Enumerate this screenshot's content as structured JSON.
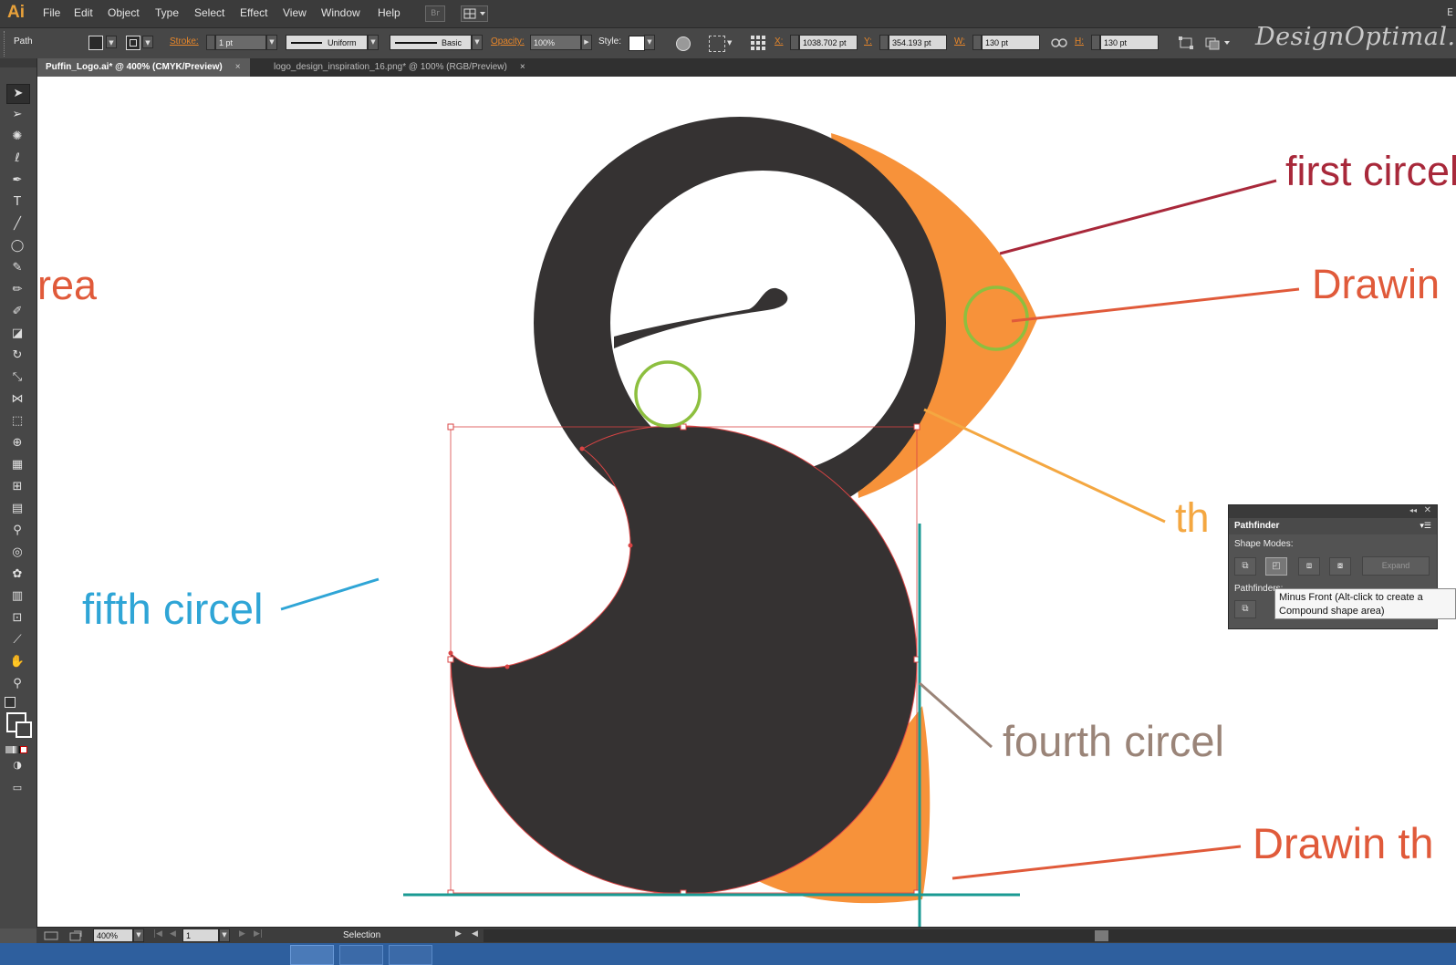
{
  "app": {
    "logo": "Ai"
  },
  "menu": [
    "File",
    "Edit",
    "Object",
    "Type",
    "Select",
    "Effect",
    "View",
    "Window",
    "Help"
  ],
  "menu_extra": {
    "bridge": "Br",
    "right_edge": "E"
  },
  "watermark": "DesignOptimal.com",
  "control_bar": {
    "selection_type": "Path",
    "stroke_label": "Stroke:",
    "stroke_weight": "1 pt",
    "profile": "Uniform",
    "brush": "Basic",
    "opacity_label": "Opacity:",
    "opacity": "100%",
    "style_label": "Style:",
    "x_label": "X:",
    "x": "1038.702 pt",
    "y_label": "Y:",
    "y": "354.193 pt",
    "w_label": "W:",
    "w": "130 pt",
    "h_label": "H:",
    "h": "130 pt"
  },
  "tabs": [
    {
      "label": "Puffin_Logo.ai* @ 400% (CMYK/Preview)",
      "active": true
    },
    {
      "label": "logo_design_inspiration_16.png* @ 100% (RGB/Preview)",
      "active": false
    }
  ],
  "tab_close": "×",
  "tools": [
    "selection-tool",
    "direct-selection-tool",
    "magic-wand-tool",
    "lasso-tool",
    "pen-tool",
    "type-tool",
    "line-segment-tool",
    "ellipse-tool",
    "paintbrush-tool",
    "pencil-tool",
    "blob-brush-tool",
    "eraser-tool",
    "rotate-tool",
    "scale-tool",
    "width-tool",
    "free-transform-tool",
    "shape-builder-tool",
    "perspective-grid-tool",
    "mesh-tool",
    "gradient-tool",
    "eyedropper-tool",
    "blend-tool",
    "symbol-sprayer-tool",
    "column-graph-tool",
    "artboard-tool",
    "slice-tool",
    "hand-tool",
    "zoom-tool"
  ],
  "annotations": {
    "first": "first circel",
    "drawing_top": "Drawin",
    "area": "rea",
    "third": "th",
    "fifth": "fifth circel",
    "fourth": "fourth circel",
    "drawin_bottom": "Drawin th"
  },
  "colors": {
    "first": "#a8283a",
    "drawing": "#e05a3a",
    "area": "#e05a3a",
    "third": "#f4a741",
    "fifth": "#2fa5d6",
    "fourth": "#9a8478",
    "drawin_bottom": "#e05a3a",
    "dark_shape": "#353232",
    "orange_shape": "#f7923a",
    "green_circle": "#8dbf3f",
    "guide": "#1a9a93",
    "selection": "#d94444"
  },
  "pathfinder": {
    "title": "Pathfinder",
    "shape_modes": "Shape Modes:",
    "pathfinders": "Pathfinders:",
    "expand": "Expand",
    "tooltip": "Minus Front (Alt-click to create a Compound shape area)"
  },
  "status": {
    "zoom": "400%",
    "artboard": "1",
    "tool": "Selection"
  }
}
